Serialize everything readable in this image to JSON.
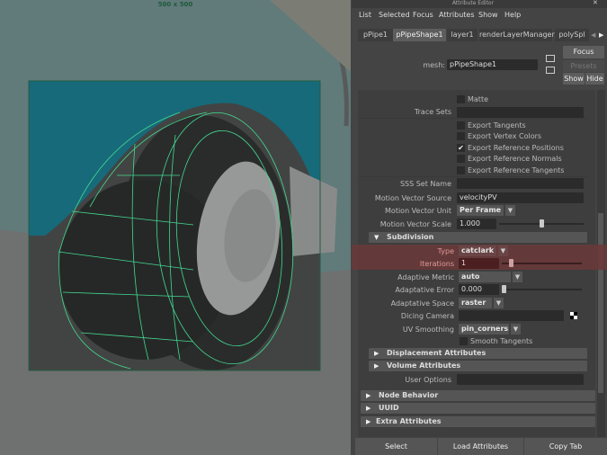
{
  "viewport": {
    "resolution_label": "500 x 500"
  },
  "editor": {
    "title": "Attribute Editor",
    "menu": [
      "List",
      "Selected",
      "Focus",
      "Attributes",
      "Show",
      "Help"
    ],
    "tabs": [
      "pPipe1",
      "pPipeShape1",
      "layer1",
      "renderLayerManager",
      "polySpl"
    ],
    "active_tab": "pPipeShape1",
    "mesh_label": "mesh:",
    "mesh_value": "pPipeShape1",
    "buttons": {
      "focus": "Focus",
      "presets": "Presets",
      "show": "Show",
      "hide": "Hide"
    },
    "attrs": {
      "matte": "Matte",
      "trace_sets": "Trace Sets",
      "export_tangents": "Export Tangents",
      "export_vertex_colors": "Export Vertex Colors",
      "export_ref_positions": "Export Reference Positions",
      "export_ref_normals": "Export Reference Normals",
      "export_ref_tangents": "Export Reference Tangents",
      "sss_set_name": "SSS Set Name",
      "mv_source_label": "Motion Vector Source",
      "mv_source_value": "velocityPV",
      "mv_unit_label": "Motion Vector Unit",
      "mv_unit_value": "Per Frame",
      "mv_scale_label": "Motion Vector Scale",
      "mv_scale_value": "1.000"
    },
    "subdivision": {
      "title": "Subdivision",
      "type_label": "Type",
      "type_value": "catclark",
      "iterations_label": "Iterations",
      "iterations_value": "1",
      "metric_label": "Adaptive Metric",
      "metric_value": "auto",
      "error_label": "Adaptative Error",
      "error_value": "0.000",
      "space_label": "Adaptative Space",
      "space_value": "raster",
      "dicing_label": "Dicing Camera",
      "uv_label": "UV Smoothing",
      "uv_value": "pin_corners",
      "smooth_tangents": "Smooth Tangents"
    },
    "sections": {
      "displacement": "Displacement Attributes",
      "volume": "Volume Attributes",
      "user_options": "User Options",
      "node_behavior": "Node Behavior",
      "uuid": "UUID",
      "extra": "Extra Attributes"
    },
    "bottom": {
      "select": "Select",
      "load": "Load Attributes",
      "copy": "Copy Tab"
    },
    "highlight_color": "#7a3a3a",
    "wire_color": "#3ee08f"
  }
}
